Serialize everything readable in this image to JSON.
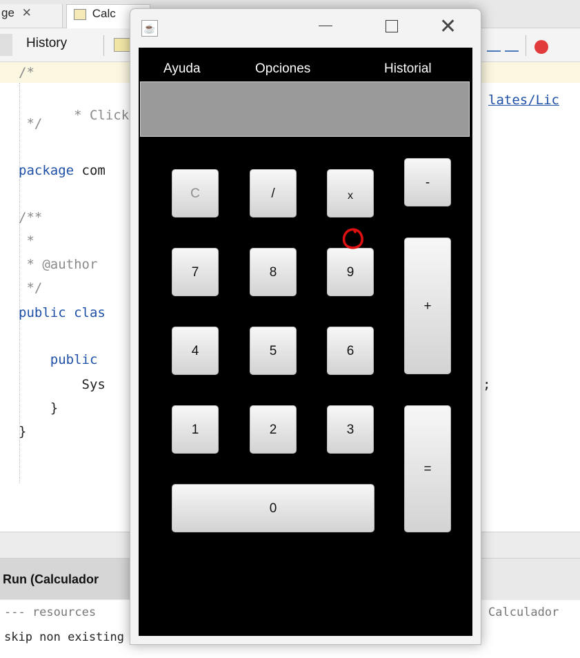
{
  "ide": {
    "tabs": [
      {
        "label": "ge",
        "close": "✕"
      },
      {
        "label": "Calc"
      }
    ],
    "toolbar": {
      "history_label": "History"
    },
    "code_lines": [
      "/*",
      " * Click nb",
      " */",
      "package com",
      "/**",
      " *",
      " * @author",
      " */",
      "public clas",
      "    public",
      "        Sys",
      "    }",
      "}"
    ],
    "code_right": [
      "lates/Lic",
      ";"
    ],
    "run_panel": {
      "label": "Run (Calculador"
    },
    "output_lines": [
      "--- resources",
      "Calculador",
      "skip non existing resourceDirectory C:\\Users\\emanu\\OneDrive\\Dc"
    ]
  },
  "calculator": {
    "titlebar": {
      "icon": "java-cup-icon",
      "minimize": "—",
      "maximize": "☐",
      "close": "✕"
    },
    "menus": [
      "Ayuda",
      "Opciones",
      "Historial"
    ],
    "display_value": "",
    "keys": {
      "clear": "C",
      "divide": "/",
      "multiply": "x",
      "minus": "-",
      "seven": "7",
      "eight": "8",
      "nine": "9",
      "plus": "+",
      "four": "4",
      "five": "5",
      "six": "6",
      "one": "1",
      "two": "2",
      "three": "3",
      "equals": "=",
      "zero": "0"
    },
    "annotation": {
      "color": "#e01010",
      "shape": "hand-drawn-circle",
      "target": "multiply"
    }
  }
}
